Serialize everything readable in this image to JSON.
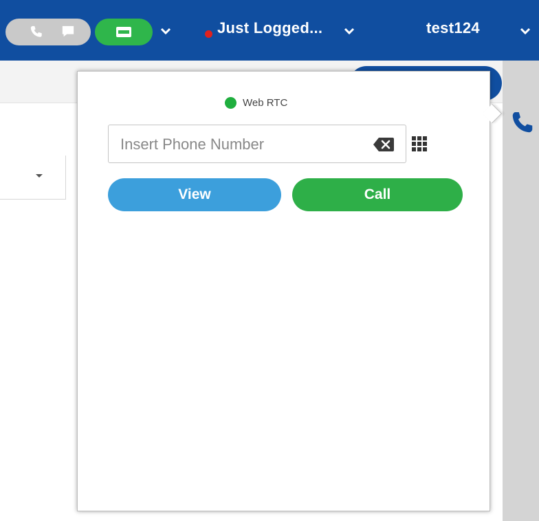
{
  "topbar": {
    "status_label": "Just Logged...",
    "status_color": "#e0211d",
    "user_label": "test124",
    "bg_color": "#104ea0",
    "icons": [
      "phone-icon",
      "chat-icon",
      "ticket-icon",
      "chevron-down-icon"
    ]
  },
  "dialer": {
    "connection_label": "Web RTC",
    "connection_color": "#1fae3e",
    "phone_placeholder": "Insert Phone Number",
    "phone_value": "",
    "view_label": "View",
    "call_label": "Call",
    "view_color": "#3c9fdc",
    "call_color": "#2eaf48"
  }
}
